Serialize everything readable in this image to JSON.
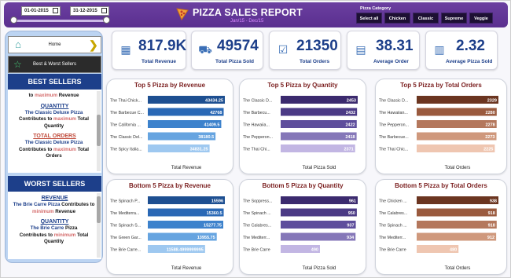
{
  "header": {
    "date_from": "01-01-2015",
    "date_to": "31-12-2015",
    "title": "PIZZA SALES REPORT",
    "subtitle": "Jan/15  -  Dec/15",
    "pizza_icon": "pizza-icon",
    "category_label": "Pizza Category",
    "categories": [
      "Select all",
      "Chicken",
      "Classic",
      "Supreme",
      "Veggie"
    ]
  },
  "sidebar": {
    "home_label": "Home",
    "best_worst_label": "Best & Worst Sellers",
    "best": {
      "head": "BEST SELLERS",
      "top_text_1": "to",
      "top_text_2": "maximum",
      "top_text_3": "Revenue",
      "qty_title": "QUANTITY",
      "qty_text_1": "The Classic Deluxe Pizza",
      "qty_text_2": "Contributes to",
      "qty_text_3": "maximum",
      "qty_text_4": "Total Quantity",
      "orders_title": "TOTAL ORDERS",
      "orders_text_1": "The Classic Deluxe Pizza",
      "orders_text_2": "Contributes to",
      "orders_text_3": "maximum",
      "orders_text_4": "Total Orders"
    },
    "worst": {
      "head": "WORST SELLERS",
      "rev_title": "REVENUE",
      "rev_text_1": "The Brie Carre Pizza",
      "rev_text_2": "Contributes to",
      "rev_text_3": "minimum",
      "rev_text_4": "Revenue",
      "qty_title": "QUANTITY",
      "qty_text_1": "The Brie Carre",
      "qty_text_2": "Pizza",
      "qty_text_3": "Contributes to",
      "qty_text_4": "minimum",
      "qty_text_5": "Total Quantity"
    }
  },
  "kpis": [
    {
      "value": "817.9K",
      "label": "Total Revenue",
      "icon": "money-icon"
    },
    {
      "value": "49574",
      "label": "Total Pizza Sold",
      "icon": "delivery-icon"
    },
    {
      "value": "21350",
      "label": "Total Orders",
      "icon": "order-list-icon"
    },
    {
      "value": "38.31",
      "label": "Average Order",
      "icon": "clipboard-icon"
    },
    {
      "value": "2.32",
      "label": "Average Pizza Sold",
      "icon": "bar-chart-icon"
    }
  ],
  "colors": {
    "header": "#5a2f8f",
    "kpi_text": "#1d3f8a",
    "chart_title": "#7a1e1e"
  },
  "chart_data": [
    {
      "type": "bar",
      "title": "Top 5 Pizza by Revenue",
      "xlabel": "Total Revenue",
      "categories": [
        "The Thai Chick...",
        "The Barbecue C...",
        "The California ...",
        "The Classic Del...",
        "The Spicy Italia..."
      ],
      "values": [
        43434.25,
        42768,
        41409.5,
        38180.5,
        34831.25
      ],
      "labels": [
        "43434.25",
        "42768",
        "41409.5",
        "38180.5",
        "34831.25"
      ],
      "colors": [
        "#1d4f91",
        "#2a68b5",
        "#3d82cc",
        "#66a4e0",
        "#9ec8f0"
      ]
    },
    {
      "type": "bar",
      "title": "Top 5 Pizza by Quantity",
      "xlabel": "Total Pizza Sold",
      "categories": [
        "The Classic D...",
        "The Barbecu...",
        "The Hawaiia...",
        "The Pepperon...",
        "The Thai Chi..."
      ],
      "values": [
        2453,
        2432,
        2422,
        2418,
        2371
      ],
      "labels": [
        "2453",
        "2432",
        "2422",
        "2418",
        "2371"
      ],
      "colors": [
        "#3b2a6e",
        "#4b3a85",
        "#5e4e9c",
        "#8577b8",
        "#c2b6e3"
      ]
    },
    {
      "type": "bar",
      "title": "Top 5 Pizza by Total Orders",
      "xlabel": "Total Orders",
      "categories": [
        "The Classic D...",
        "The Hawaiian...",
        "The Pepperon...",
        "The Barbecue...",
        "The Thai Chic..."
      ],
      "values": [
        2329,
        2280,
        2278,
        2273,
        2225
      ],
      "labels": [
        "2329",
        "2280",
        "2278",
        "2273",
        "2225"
      ],
      "colors": [
        "#6b3520",
        "#9a5a3e",
        "#b4775c",
        "#cf987c",
        "#efc6b1"
      ]
    },
    {
      "type": "bar",
      "title": "Bottom 5 Pizza by Revenue",
      "xlabel": "Total Revenue",
      "categories": [
        "The Spinach P...",
        "The Mediterra...",
        "The Spinach S...",
        "The Green Gar...",
        "The Brie Carre..."
      ],
      "values": [
        15596,
        15360.5,
        15277.75,
        13955.75,
        11588.5
      ],
      "labels": [
        "15596",
        "15360.5",
        "15277.75",
        "13955.75",
        "11588.4999999995"
      ],
      "colors": [
        "#1d4f91",
        "#2a68b5",
        "#3d82cc",
        "#66a4e0",
        "#9ec8f0"
      ]
    },
    {
      "type": "bar",
      "title": "Bottom 5 Pizza by Quantity",
      "xlabel": "Total Pizza Sold",
      "categories": [
        "The Soppress...",
        "The Spinach ...",
        "The Calabres...",
        "The Mediterr...",
        "The Brie Carre"
      ],
      "values": [
        961,
        950,
        937,
        934,
        490
      ],
      "labels": [
        "961",
        "950",
        "937",
        "934",
        "490"
      ],
      "colors": [
        "#3b2a6e",
        "#4b3a85",
        "#5e4e9c",
        "#8577b8",
        "#c2b6e3"
      ]
    },
    {
      "type": "bar",
      "title": "Bottom 5 Pizza by Total Orders",
      "xlabel": "Total Orders",
      "categories": [
        "The Chicken ...",
        "The Calabres...",
        "The Spinach ...",
        "The Mediterr...",
        "The Brie Carre"
      ],
      "values": [
        938,
        918,
        918,
        912,
        480
      ],
      "labels": [
        "938",
        "918",
        "918",
        "912",
        "480"
      ],
      "colors": [
        "#6b3520",
        "#9a5a3e",
        "#b4775c",
        "#cf987c",
        "#efc6b1"
      ]
    }
  ]
}
